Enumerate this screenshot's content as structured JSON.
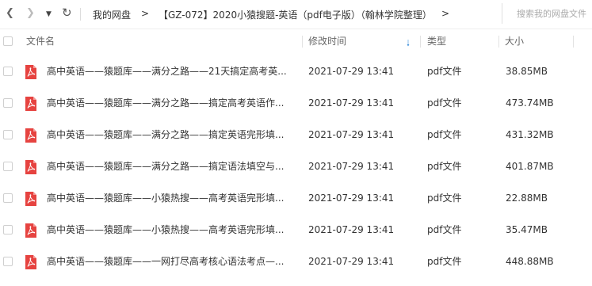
{
  "toolbar": {
    "back_icon": "chevron-left-icon",
    "forward_icon": "chevron-right-icon",
    "dropdown_icon": "caret-down-icon",
    "refresh_icon": "refresh-icon",
    "breadcrumb": [
      "我的网盘",
      "【GZ-072】2020小猿搜题-英语（pdf电子版）（翰林学院整理）"
    ],
    "breadcrumb_separator": ">",
    "search_placeholder": "搜索我的网盘文件"
  },
  "table": {
    "columns": {
      "name": "文件名",
      "modified": "修改时间",
      "type": "类型",
      "size": "大小"
    },
    "sort_icon": "sort-arrow-down-icon",
    "accent_color": "#3b8fdc",
    "pdf_icon_color": "#e64340",
    "rows": [
      {
        "name": "高中英语——猿题库——满分之路——21天搞定高考英...",
        "modified": "2021-07-29 13:41",
        "type": "pdf文件",
        "size": "38.85MB"
      },
      {
        "name": "高中英语——猿题库——满分之路——搞定高考英语作...",
        "modified": "2021-07-29 13:41",
        "type": "pdf文件",
        "size": "473.74MB"
      },
      {
        "name": "高中英语——猿题库——满分之路——搞定英语完形填...",
        "modified": "2021-07-29 13:41",
        "type": "pdf文件",
        "size": "431.32MB"
      },
      {
        "name": "高中英语——猿题库——满分之路——搞定语法填空与...",
        "modified": "2021-07-29 13:41",
        "type": "pdf文件",
        "size": "401.87MB"
      },
      {
        "name": "高中英语——猿题库——小猿热搜——高考英语完形填...",
        "modified": "2021-07-29 13:41",
        "type": "pdf文件",
        "size": "22.88MB"
      },
      {
        "name": "高中英语——猿题库——小猿热搜——高考英语完形填...",
        "modified": "2021-07-29 13:41",
        "type": "pdf文件",
        "size": "35.47MB"
      },
      {
        "name": "高中英语——猿题库——一网打尽高考核心语法考点—...",
        "modified": "2021-07-29 13:41",
        "type": "pdf文件",
        "size": "448.88MB"
      }
    ]
  }
}
